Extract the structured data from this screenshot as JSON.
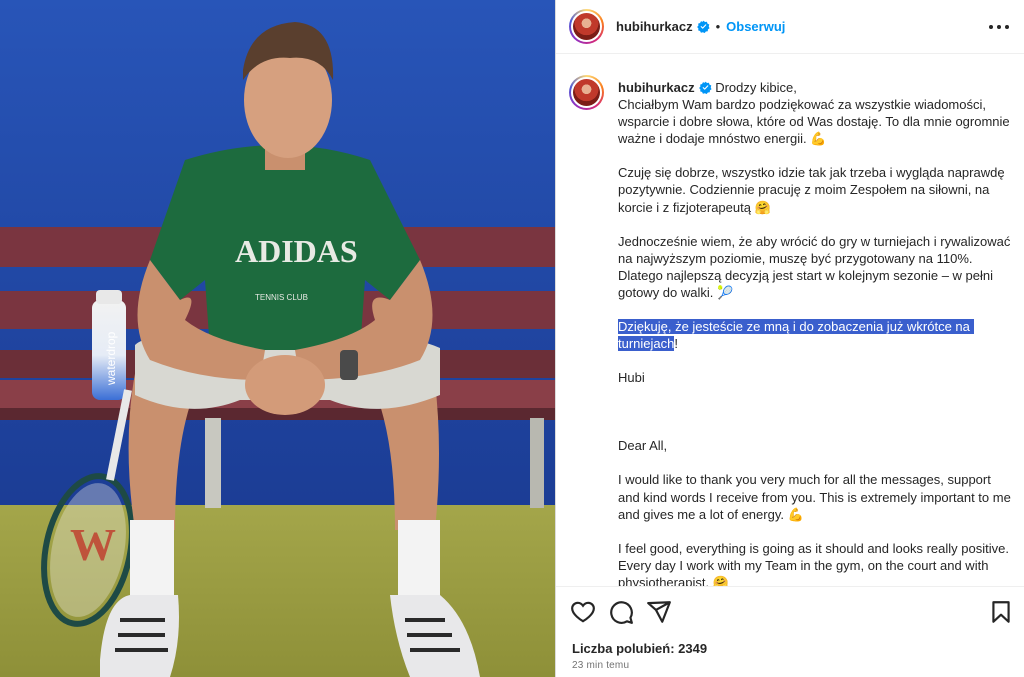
{
  "post": {
    "username": "hubihurkacz",
    "follow_label": "Obserwuj",
    "dot": "•",
    "photo": {
      "shirt_text": "ADIDAS",
      "shirt_sub": "TENNIS CLUB",
      "bottle_text": "waterdrop"
    }
  },
  "caption": {
    "first_line": "Drodzy kibice,",
    "pl_p1": "Chciałbym Wam bardzo podziękować za wszystkie wiadomości, wsparcie i dobre słowa, które od Was dostaję. To dla mnie ogromnie ważne i dodaje mnóstwo energii.",
    "pl_p2": "Czuję się dobrze, wszystko idzie tak jak trzeba i wygląda naprawdę pozytywnie. Codziennie pracuję z moim Zespołem na siłowni, na korcie i z fizjoterapeutą",
    "pl_p3": "Jednocześnie wiem, że aby wrócić do gry w turniejach i rywalizować na najwyższym poziomie, muszę być przygotowany na 110%. Dlatego najlepszą decyzją jest start w kolejnym sezonie – w pełni gotowy do walki.",
    "pl_p4_selected": "Dziękuję, że jesteście ze mną i do zobaczenia już wkrótce na turniejach",
    "pl_p4_end": "!",
    "sign": "Hubi",
    "en_greeting": "Dear All,",
    "en_p1": "I would like to thank you very much for all the messages, support and kind words I receive from you. This is extremely important to me and gives me a lot of energy.",
    "en_p2": "I feel good, everything is going as it should and looks really positive. Every day I work with my Team in the gym, on the court and with physiotherapist.",
    "emoji_muscle": "💪",
    "emoji_hug": "🤗",
    "emoji_racket": "🎾"
  },
  "footer": {
    "likes_label": "Liczba polubień: 2349",
    "time_label": "23 min temu"
  },
  "colors": {
    "accent": "#0095f6",
    "selection": "#3a5fcd",
    "wall": "#1f47a8",
    "shirt": "#1d6b3e"
  },
  "icons": [
    "verified-icon",
    "more-options-icon",
    "heart-icon",
    "comment-icon",
    "share-icon",
    "bookmark-icon"
  ]
}
